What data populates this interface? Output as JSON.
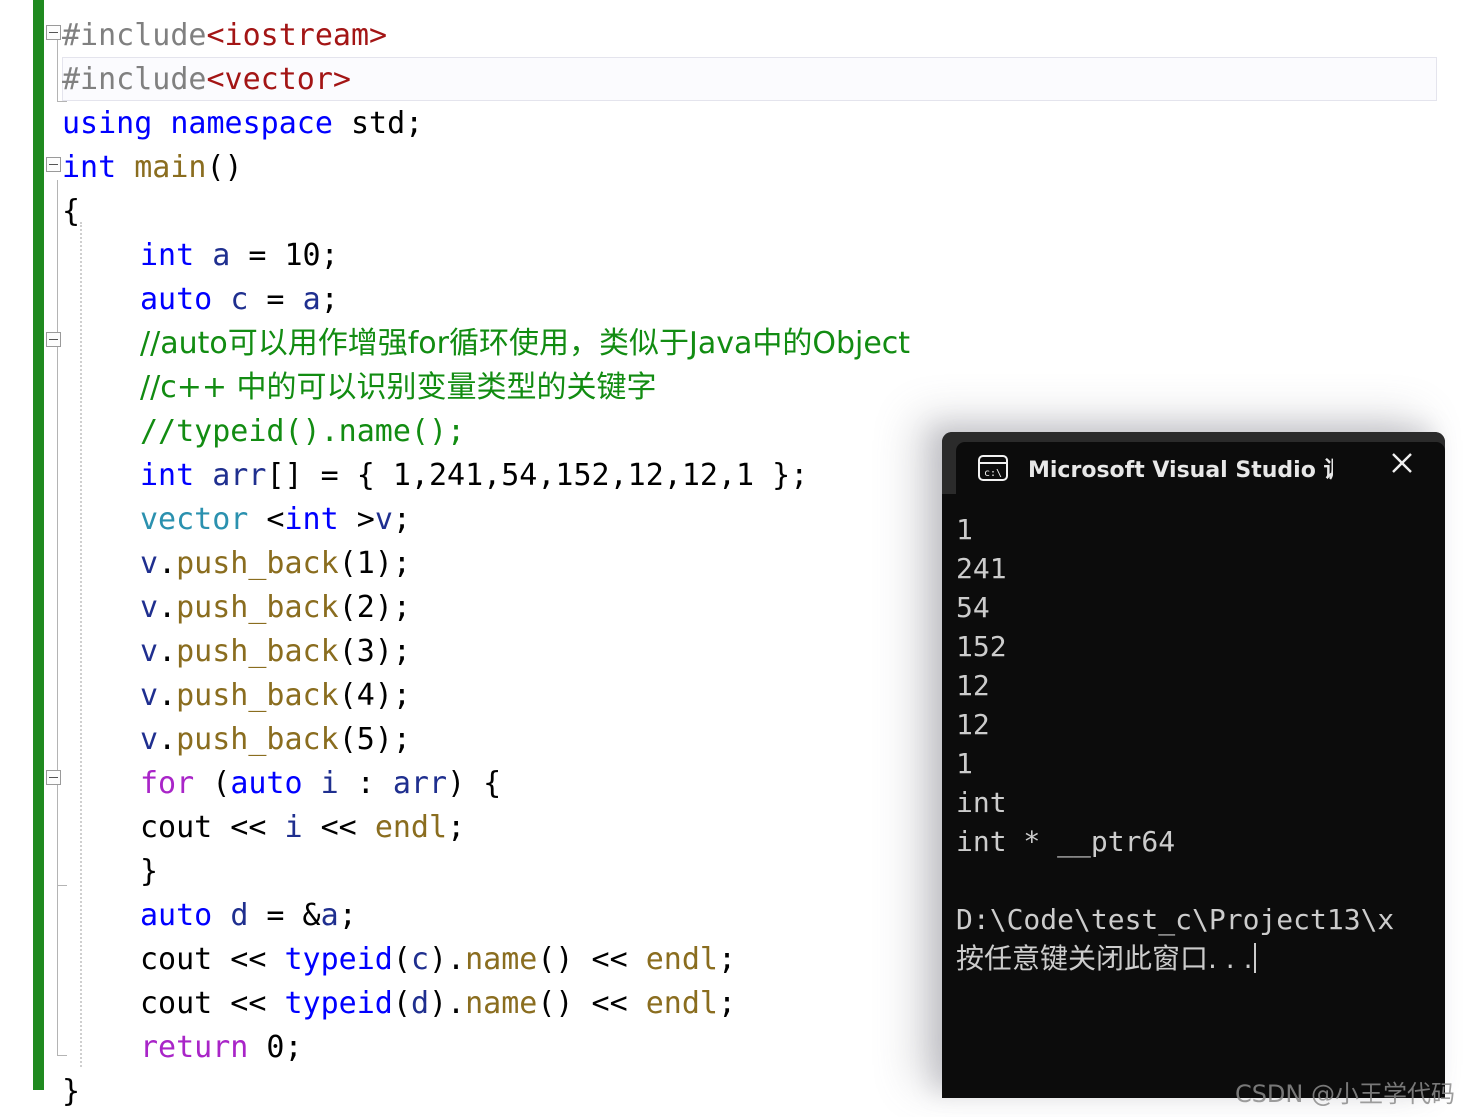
{
  "editor": {
    "name": "visual-studio-cpp-editor",
    "change_bar_color": "#1f8a1f",
    "lines": [
      {
        "id": "l1",
        "indent": 0,
        "tokens": [
          {
            "t": "#include",
            "c": "pre"
          },
          {
            "t": "<iostream>",
            "c": "str"
          }
        ]
      },
      {
        "id": "l2",
        "indent": 0,
        "tokens": [
          {
            "t": "#include",
            "c": "pre"
          },
          {
            "t": "<vector>",
            "c": "str"
          }
        ]
      },
      {
        "id": "l3",
        "indent": 0,
        "tokens": [
          {
            "t": "using",
            "c": "kw"
          },
          {
            "t": " ",
            "c": "plain"
          },
          {
            "t": "namespace",
            "c": "kw"
          },
          {
            "t": " std;",
            "c": "plain"
          }
        ]
      },
      {
        "id": "l4",
        "indent": 0,
        "tokens": [
          {
            "t": "int",
            "c": "kw"
          },
          {
            "t": " ",
            "c": "plain"
          },
          {
            "t": "main",
            "c": "fn"
          },
          {
            "t": "()",
            "c": "plain"
          }
        ]
      },
      {
        "id": "l5",
        "indent": 0,
        "tokens": [
          {
            "t": "{",
            "c": "plain"
          }
        ]
      },
      {
        "id": "l6",
        "indent": 1,
        "tokens": [
          {
            "t": "int",
            "c": "kw"
          },
          {
            "t": " ",
            "c": "plain"
          },
          {
            "t": "a",
            "c": "var"
          },
          {
            "t": " = 10;",
            "c": "plain"
          }
        ]
      },
      {
        "id": "l7",
        "indent": 1,
        "tokens": [
          {
            "t": "auto",
            "c": "kw"
          },
          {
            "t": " ",
            "c": "plain"
          },
          {
            "t": "c",
            "c": "var"
          },
          {
            "t": " = ",
            "c": "plain"
          },
          {
            "t": "a",
            "c": "var"
          },
          {
            "t": ";",
            "c": "plain"
          }
        ]
      },
      {
        "id": "l8",
        "indent": 1,
        "cjk": true,
        "tokens": [
          {
            "t": "//auto可以用作增强for循环使用，类似于Java中的Object",
            "c": "comment"
          }
        ]
      },
      {
        "id": "l9",
        "indent": 1,
        "cjk": true,
        "tokens": [
          {
            "t": "//c++ 中的可以识别变量类型的关键字",
            "c": "comment"
          }
        ]
      },
      {
        "id": "l10",
        "indent": 1,
        "tokens": [
          {
            "t": "//typeid().name();",
            "c": "comment"
          }
        ]
      },
      {
        "id": "l11",
        "indent": 1,
        "tokens": [
          {
            "t": "int",
            "c": "kw"
          },
          {
            "t": " ",
            "c": "plain"
          },
          {
            "t": "arr",
            "c": "var"
          },
          {
            "t": "[] = { 1,241,54,152,12,12,1 };",
            "c": "plain"
          }
        ]
      },
      {
        "id": "l12",
        "indent": 1,
        "tokens": [
          {
            "t": "vector",
            "c": "type"
          },
          {
            "t": " <",
            "c": "plain"
          },
          {
            "t": "int",
            "c": "kw"
          },
          {
            "t": " >",
            "c": "plain"
          },
          {
            "t": "v",
            "c": "var"
          },
          {
            "t": ";",
            "c": "plain"
          }
        ]
      },
      {
        "id": "l13",
        "indent": 1,
        "tokens": [
          {
            "t": "v",
            "c": "var"
          },
          {
            "t": ".",
            "c": "plain"
          },
          {
            "t": "push_back",
            "c": "fn"
          },
          {
            "t": "(1);",
            "c": "plain"
          }
        ]
      },
      {
        "id": "l14",
        "indent": 1,
        "tokens": [
          {
            "t": "v",
            "c": "var"
          },
          {
            "t": ".",
            "c": "plain"
          },
          {
            "t": "push_back",
            "c": "fn"
          },
          {
            "t": "(2);",
            "c": "plain"
          }
        ]
      },
      {
        "id": "l15",
        "indent": 1,
        "tokens": [
          {
            "t": "v",
            "c": "var"
          },
          {
            "t": ".",
            "c": "plain"
          },
          {
            "t": "push_back",
            "c": "fn"
          },
          {
            "t": "(3);",
            "c": "plain"
          }
        ]
      },
      {
        "id": "l16",
        "indent": 1,
        "tokens": [
          {
            "t": "v",
            "c": "var"
          },
          {
            "t": ".",
            "c": "plain"
          },
          {
            "t": "push_back",
            "c": "fn"
          },
          {
            "t": "(4);",
            "c": "plain"
          }
        ]
      },
      {
        "id": "l17",
        "indent": 1,
        "tokens": [
          {
            "t": "v",
            "c": "var"
          },
          {
            "t": ".",
            "c": "plain"
          },
          {
            "t": "push_back",
            "c": "fn"
          },
          {
            "t": "(5);",
            "c": "plain"
          }
        ]
      },
      {
        "id": "l18",
        "indent": 1,
        "tokens": [
          {
            "t": "for",
            "c": "ctrl"
          },
          {
            "t": " (",
            "c": "plain"
          },
          {
            "t": "auto",
            "c": "kw"
          },
          {
            "t": " ",
            "c": "plain"
          },
          {
            "t": "i",
            "c": "var"
          },
          {
            "t": " : ",
            "c": "plain"
          },
          {
            "t": "arr",
            "c": "var"
          },
          {
            "t": ") {",
            "c": "plain"
          }
        ]
      },
      {
        "id": "l19",
        "indent": 1,
        "tokens": [
          {
            "t": "cout << ",
            "c": "plain"
          },
          {
            "t": "i",
            "c": "var"
          },
          {
            "t": " << ",
            "c": "plain"
          },
          {
            "t": "endl",
            "c": "fn"
          },
          {
            "t": ";",
            "c": "plain"
          }
        ]
      },
      {
        "id": "l20",
        "indent": 1,
        "tokens": [
          {
            "t": "}",
            "c": "plain"
          }
        ]
      },
      {
        "id": "l21",
        "indent": 1,
        "tokens": [
          {
            "t": "auto",
            "c": "kw"
          },
          {
            "t": " ",
            "c": "plain"
          },
          {
            "t": "d",
            "c": "var"
          },
          {
            "t": " = &",
            "c": "plain"
          },
          {
            "t": "a",
            "c": "var"
          },
          {
            "t": ";",
            "c": "plain"
          }
        ]
      },
      {
        "id": "l22",
        "indent": 1,
        "tokens": [
          {
            "t": "cout << ",
            "c": "plain"
          },
          {
            "t": "typeid",
            "c": "kw"
          },
          {
            "t": "(",
            "c": "plain"
          },
          {
            "t": "c",
            "c": "var"
          },
          {
            "t": ").",
            "c": "plain"
          },
          {
            "t": "name",
            "c": "fn"
          },
          {
            "t": "() << ",
            "c": "plain"
          },
          {
            "t": "endl",
            "c": "fn"
          },
          {
            "t": ";",
            "c": "plain"
          }
        ]
      },
      {
        "id": "l23",
        "indent": 1,
        "tokens": [
          {
            "t": "cout << ",
            "c": "plain"
          },
          {
            "t": "typeid",
            "c": "kw"
          },
          {
            "t": "(",
            "c": "plain"
          },
          {
            "t": "d",
            "c": "var"
          },
          {
            "t": ").",
            "c": "plain"
          },
          {
            "t": "name",
            "c": "fn"
          },
          {
            "t": "() << ",
            "c": "plain"
          },
          {
            "t": "endl",
            "c": "fn"
          },
          {
            "t": ";",
            "c": "plain"
          }
        ]
      },
      {
        "id": "l24",
        "indent": 1,
        "tokens": [
          {
            "t": "return",
            "c": "ctrl"
          },
          {
            "t": " 0;",
            "c": "plain"
          }
        ]
      },
      {
        "id": "l25",
        "indent": 0,
        "tokens": [
          {
            "t": "}",
            "c": "plain"
          }
        ]
      }
    ]
  },
  "console": {
    "title": "Microsoft Visual Studio 调试控",
    "icon": "terminal-cmd-icon",
    "close_label": "✕",
    "background": "#0c0c0c",
    "titlebar_background": "#2b2b2b",
    "text_color": "#cccccc",
    "output": [
      {
        "text": "1"
      },
      {
        "text": "241"
      },
      {
        "text": "54"
      },
      {
        "text": "152"
      },
      {
        "text": "12"
      },
      {
        "text": "12"
      },
      {
        "text": "1"
      },
      {
        "text": "int"
      },
      {
        "text": "int * __ptr64"
      },
      {
        "text": "",
        "blank": true
      },
      {
        "text": "D:\\Code\\test_c\\Project13\\x"
      },
      {
        "text": "按任意键关闭此窗口. . .",
        "cjk": true,
        "caret": true
      }
    ]
  },
  "watermark": {
    "text": "CSDN @小王学代码"
  }
}
